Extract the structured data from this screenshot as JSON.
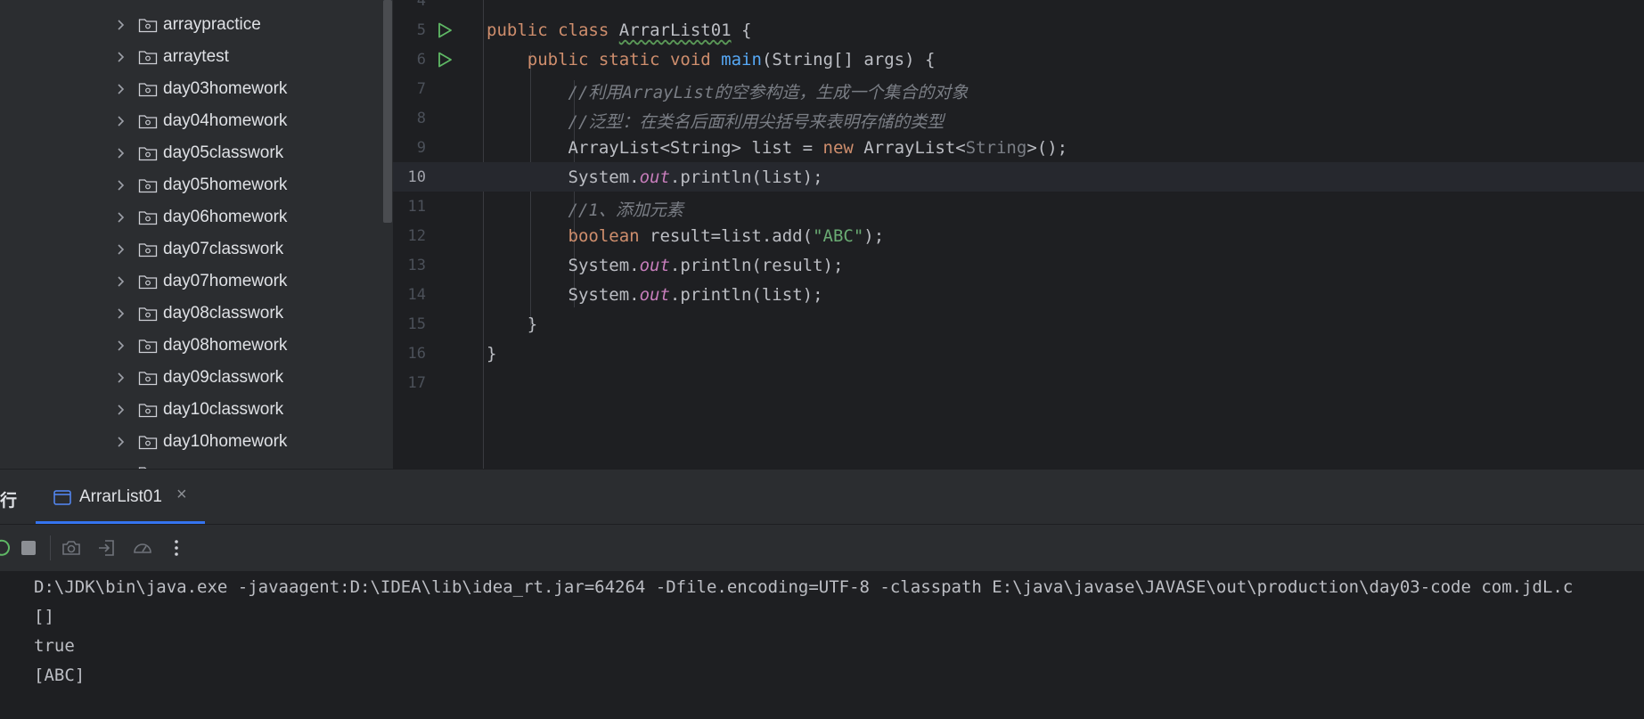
{
  "sidebar": {
    "items": [
      {
        "label": "arraypractice"
      },
      {
        "label": "arraytest"
      },
      {
        "label": "day03homework"
      },
      {
        "label": "day04homework"
      },
      {
        "label": "day05classwork"
      },
      {
        "label": "day05homework"
      },
      {
        "label": "day06homework"
      },
      {
        "label": "day07classwork"
      },
      {
        "label": "day07homework"
      },
      {
        "label": "day08classwork"
      },
      {
        "label": "day08homework"
      },
      {
        "label": "day09classwork"
      },
      {
        "label": "day10classwork"
      },
      {
        "label": "day10homework"
      }
    ],
    "item_icon": "package-folder-icon",
    "expand_icon": "chevron-right-icon"
  },
  "editor": {
    "current_line": "10",
    "line_numbers": [
      "4",
      "5",
      "6",
      "7",
      "8",
      "9",
      "10",
      "11",
      "12",
      "13",
      "14",
      "15",
      "16",
      "17"
    ],
    "code": {
      "l5_public": "public",
      "l5_class": "class",
      "l5_name": "ArrarList01",
      "l5_brace": " {",
      "l6_public": "public",
      "l6_static": "static",
      "l6_void": "void",
      "l6_main": "main",
      "l6_params": "(String[] args) {",
      "l7_comment": "//利用ArrayList的空参构造，生成一个集合的对象",
      "l8_comment": "//泛型：在类名后面利用尖括号来表明存储的类型",
      "l9_decl": "ArrayList<String> list = ",
      "l9_new": "new",
      "l9_type": " ArrayList<",
      "l9_generic": "String",
      "l9_end": ">();",
      "l10_sys": "System.",
      "l10_out": "out",
      "l10_call": ".println(list);",
      "l11_comment": "//1、添加元素",
      "l12_boolean": "boolean",
      "l12_assign": " result=list.add(",
      "l12_str": "\"ABC\"",
      "l12_end": ");",
      "l13_sys": "System.",
      "l13_out": "out",
      "l13_call": ".println(result);",
      "l14_sys": "System.",
      "l14_out": "out",
      "l14_call": ".println(list);",
      "l15_brace": "}",
      "l16_brace": "}"
    },
    "run_icon": "run-gutter-icon"
  },
  "run_panel": {
    "title": "行",
    "tab_label": "ArrarList01",
    "tab_close": "×",
    "toolbar_icons": [
      "rerun-icon",
      "stop-icon",
      "camera-icon",
      "login-icon",
      "profiler-icon",
      "more-vertical-icon"
    ],
    "console_lines": [
      "D:\\JDK\\bin\\java.exe -javaagent:D:\\IDEA\\lib\\idea_rt.jar=64264 -Dfile.encoding=UTF-8 -classpath E:\\java\\javase\\JAVASE\\out\\production\\day03-code com.jdL.c",
      "[]",
      "true",
      "[ABC]"
    ]
  },
  "colors": {
    "keyword": "#cf8e6d",
    "function": "#56a8f5",
    "string": "#6aab73",
    "static_field": "#c77dbb",
    "comment": "#7a7e85",
    "accent": "#3574f0"
  }
}
